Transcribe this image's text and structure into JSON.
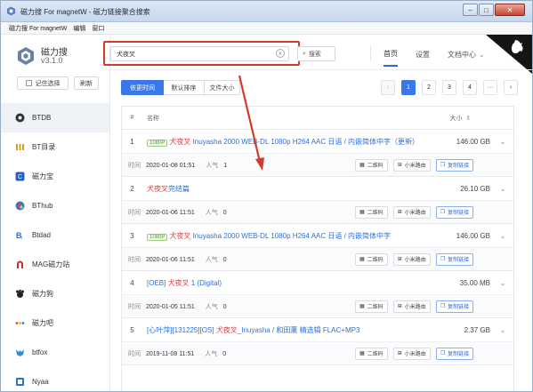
{
  "window": {
    "title": "磁力搜 For magnetW - 磁力链接聚合搜索",
    "controls": {
      "minimize": "–",
      "maximize": "□",
      "close": "✕"
    }
  },
  "menu": {
    "items": [
      "磁力搜 For magnetW",
      "编辑",
      "窗口"
    ]
  },
  "app": {
    "name": "磁力搜",
    "version": "v3.1.0"
  },
  "sidebar": {
    "buttons": {
      "remember": "记住选择",
      "refresh": "刷新"
    },
    "sites": [
      {
        "label": "BTDB",
        "icon": "btdb-icon",
        "active": true
      },
      {
        "label": "BT目录",
        "icon": "btmulu-icon"
      },
      {
        "label": "磁力宝",
        "icon": "cilibao-icon"
      },
      {
        "label": "BThub",
        "icon": "bthub-icon"
      },
      {
        "label": "Btdad",
        "icon": "btdad-icon"
      },
      {
        "label": "MAG磁力站",
        "icon": "magnet-icon"
      },
      {
        "label": "磁力狗",
        "icon": "dog-icon"
      },
      {
        "label": "磁力吧",
        "icon": "ciliba-icon"
      },
      {
        "label": "btfox",
        "icon": "fox-icon"
      },
      {
        "label": "Nyaa",
        "icon": "nyaa-icon"
      }
    ]
  },
  "search": {
    "value": "犬夜叉",
    "button": "搜索",
    "clear_icon": "circle-x-icon",
    "button_icon": "search-icon"
  },
  "nav": {
    "tabs": [
      "首页",
      "设置",
      "文档中心"
    ],
    "active": "首页",
    "dropdown": "⌄"
  },
  "sort": {
    "options": [
      "依更时间",
      "默认排序",
      "文件大小"
    ],
    "active": "依更时间"
  },
  "pagination": {
    "prev": "‹",
    "pages": [
      "1",
      "2",
      "3",
      "4"
    ],
    "ellipsis": "···",
    "next": "›",
    "current": "1"
  },
  "table": {
    "headers": {
      "index": "#",
      "name": "名称",
      "size": "大小",
      "size_sort_icon": "⇕"
    },
    "meta_labels": {
      "time": "时间",
      "hot": "人气"
    },
    "actions": {
      "qrcode": "二维码",
      "router": "小米路由",
      "copy": "复制链接"
    },
    "rows": [
      {
        "index": "1",
        "tag": "1080P",
        "pre": "",
        "keyword": "犬夜叉",
        "rest": " Inuyasha 2000 WEB-DL 1080p H264 AAC 日语 / 内嵌简体中字（更新）",
        "size": "146.00 GB",
        "time": "2020-01-08 01:51",
        "hot": "1"
      },
      {
        "index": "2",
        "tag": "",
        "pre": "",
        "keyword": "犬夜叉",
        "rest": "完结篇",
        "size": "26.10 GB",
        "time": "2020-01-06 11:51",
        "hot": "0"
      },
      {
        "index": "3",
        "tag": "1080P",
        "pre": "",
        "keyword": "犬夜叉",
        "rest": " Inuyasha 2000 WEB-DL 1080p H264 AAC 日语 / 内嵌简体中字",
        "size": "146.00 GB",
        "time": "2020-01-06 11:51",
        "hot": "0"
      },
      {
        "index": "4",
        "tag": "",
        "pre": "[OEB] ",
        "keyword": "犬夜叉",
        "rest": " 1 (Digital)",
        "size": "35.00 MB",
        "time": "2020-01-05 11:51",
        "hot": "0"
      },
      {
        "index": "5",
        "tag": "",
        "pre": "[心叶萍][131225][OS] ",
        "keyword": "犬夜叉",
        "rest": "_Inuyasha / 和田薰 精选辑 FLAC+MP3",
        "size": "2.37 GB",
        "time": "2019-11-08 11:51",
        "hot": "0"
      }
    ]
  },
  "colors": {
    "accent": "#3b78e7",
    "keyword": "#e03c3c",
    "annotation": "#d23b2b",
    "tag_green": "#56a32a"
  }
}
